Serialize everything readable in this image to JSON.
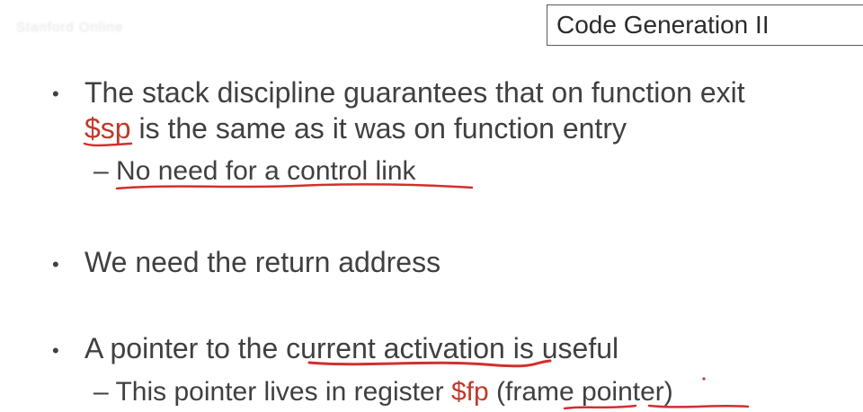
{
  "watermark": "Stanford Online",
  "title": "Code Generation II",
  "bullets": [
    {
      "line1": "The stack discipline guarantees that on function exit",
      "line2_register": "$sp",
      "line2_rest": " is the same as it was on function entry",
      "sub": {
        "dash": "–",
        "text": "No need for a control link"
      }
    },
    {
      "text": "We need the return address"
    },
    {
      "before": "A pointer to the ",
      "emph": "current activation",
      "after": " is useful",
      "sub": {
        "dash": "–",
        "before": "This pointer lives in register ",
        "register": "$fp",
        "middle": " (",
        "frame": "frame",
        "space": " ",
        "pointer": "pointer",
        "close": ")"
      }
    }
  ],
  "colors": {
    "text": "#404040",
    "register": "#c0392b",
    "annotation": "#d32f2f"
  }
}
